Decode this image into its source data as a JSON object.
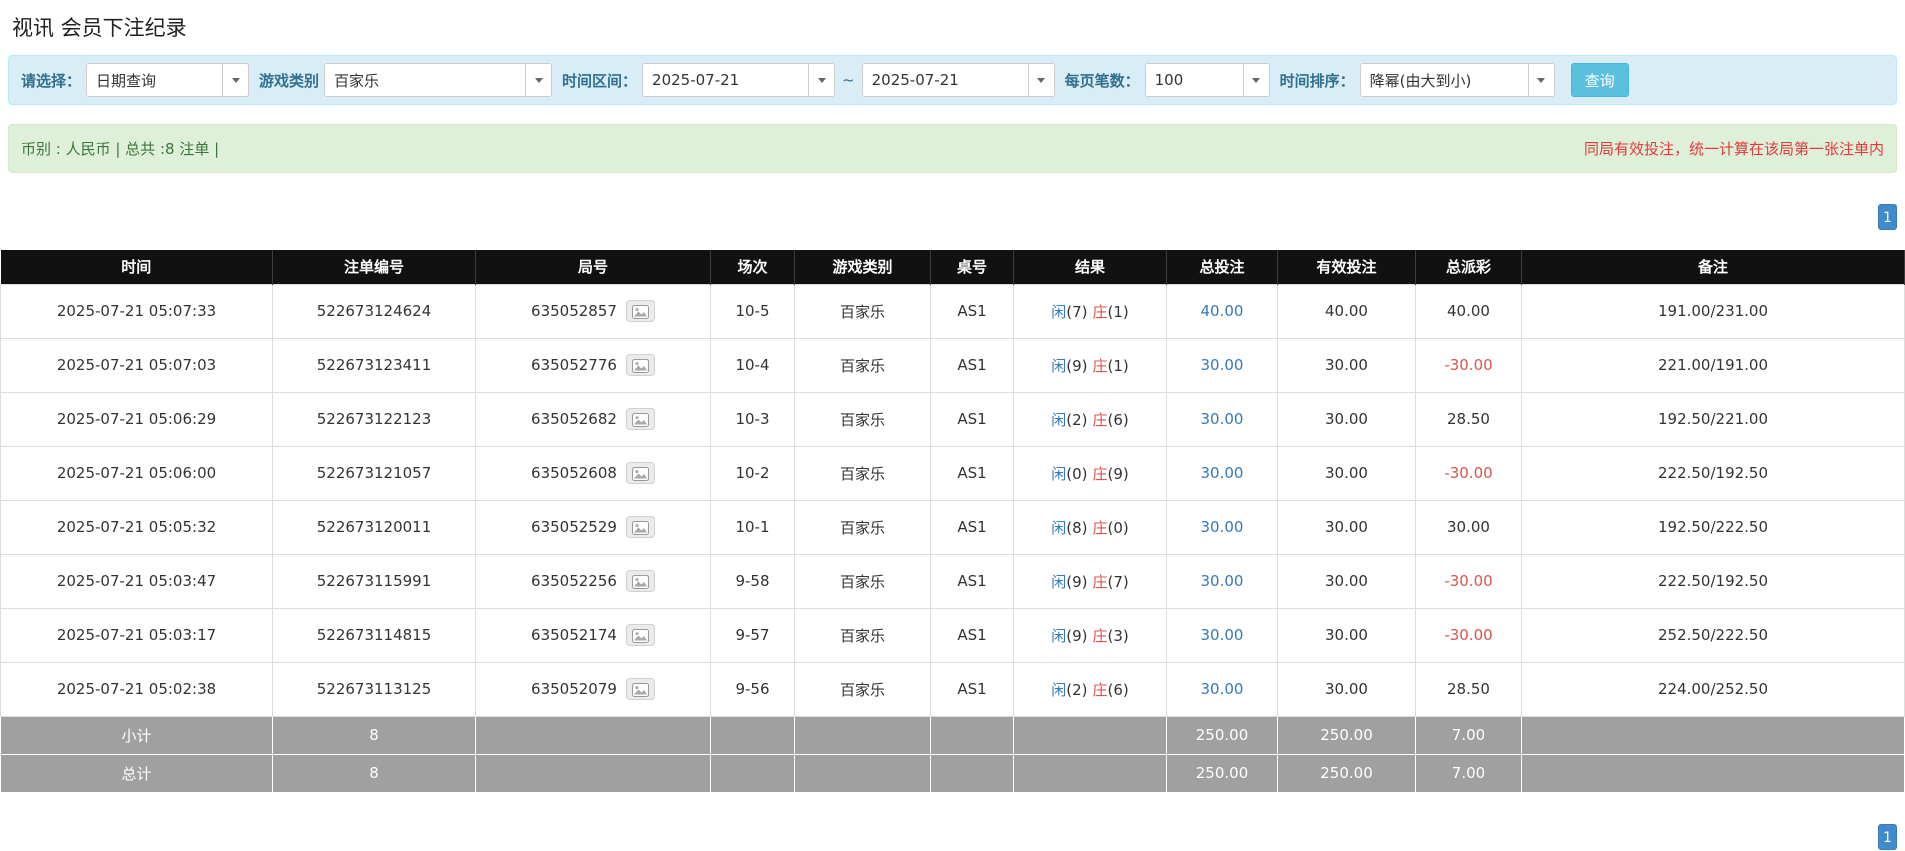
{
  "page": {
    "title": "视讯 会员下注纪录"
  },
  "filters": {
    "select_label": "请选择：",
    "select_value": "日期查询",
    "game_type_label": "游戏类别",
    "game_type_value": "百家乐",
    "date_range_label": "时间区间：",
    "date_from": "2025-07-21",
    "date_separator": "~",
    "date_to": "2025-07-21",
    "page_size_label": "每页笔数：",
    "page_size_value": "100",
    "sort_label": "时间排序：",
    "sort_value": "降幂(由大到小)",
    "search_button": "查询"
  },
  "summary": {
    "left": "币别 : 人民币 | 总共 :8 注单 |",
    "right": "同局有效投注，统一计算在该局第一张注单内"
  },
  "pagination": {
    "page": "1"
  },
  "icons": {
    "dropdown_caret": "caret-down-icon",
    "round_result": "cards-icon"
  },
  "colors": {
    "filter_bar_bg": "#d9edf7",
    "filter_label": "#31708f",
    "summary_bar_bg": "#dff0d8",
    "summary_text": "#3c763d",
    "notice_red": "#e4393c",
    "link_blue": "#337ab7",
    "player_blue": "#337ab7",
    "banker_red": "#d9534f",
    "negative_red": "#d9534f",
    "table_header_bg": "#111111",
    "table_footer_bg": "#a0a0a0",
    "search_button_bg": "#5bc0de",
    "pagination_bg": "#428bca"
  },
  "table": {
    "headers": [
      "时间",
      "注单编号",
      "局号",
      "场次",
      "游戏类别",
      "桌号",
      "结果",
      "总投注",
      "有效投注",
      "总派彩",
      "备注"
    ],
    "rows": [
      {
        "time": "2025-07-21 05:07:33",
        "bet_id": "522673124624",
        "round_id": "635052857",
        "session": "10-5",
        "game": "百家乐",
        "table_no": "AS1",
        "player": "闲",
        "player_score": "(7)",
        "banker": "庄",
        "banker_score": "(1)",
        "total_bet": "40.00",
        "valid_bet": "40.00",
        "payout": "40.00",
        "remark": "191.00/231.00"
      },
      {
        "time": "2025-07-21 05:07:03",
        "bet_id": "522673123411",
        "round_id": "635052776",
        "session": "10-4",
        "game": "百家乐",
        "table_no": "AS1",
        "player": "闲",
        "player_score": "(9)",
        "banker": "庄",
        "banker_score": "(1)",
        "total_bet": "30.00",
        "valid_bet": "30.00",
        "payout": "-30.00",
        "remark": "221.00/191.00"
      },
      {
        "time": "2025-07-21 05:06:29",
        "bet_id": "522673122123",
        "round_id": "635052682",
        "session": "10-3",
        "game": "百家乐",
        "table_no": "AS1",
        "player": "闲",
        "player_score": "(2)",
        "banker": "庄",
        "banker_score": "(6)",
        "total_bet": "30.00",
        "valid_bet": "30.00",
        "payout": "28.50",
        "remark": "192.50/221.00"
      },
      {
        "time": "2025-07-21 05:06:00",
        "bet_id": "522673121057",
        "round_id": "635052608",
        "session": "10-2",
        "game": "百家乐",
        "table_no": "AS1",
        "player": "闲",
        "player_score": "(0)",
        "banker": "庄",
        "banker_score": "(9)",
        "total_bet": "30.00",
        "valid_bet": "30.00",
        "payout": "-30.00",
        "remark": "222.50/192.50"
      },
      {
        "time": "2025-07-21 05:05:32",
        "bet_id": "522673120011",
        "round_id": "635052529",
        "session": "10-1",
        "game": "百家乐",
        "table_no": "AS1",
        "player": "闲",
        "player_score": "(8)",
        "banker": "庄",
        "banker_score": "(0)",
        "total_bet": "30.00",
        "valid_bet": "30.00",
        "payout": "30.00",
        "remark": "192.50/222.50"
      },
      {
        "time": "2025-07-21 05:03:47",
        "bet_id": "522673115991",
        "round_id": "635052256",
        "session": "9-58",
        "game": "百家乐",
        "table_no": "AS1",
        "player": "闲",
        "player_score": "(9)",
        "banker": "庄",
        "banker_score": "(7)",
        "total_bet": "30.00",
        "valid_bet": "30.00",
        "payout": "-30.00",
        "remark": "222.50/192.50"
      },
      {
        "time": "2025-07-21 05:03:17",
        "bet_id": "522673114815",
        "round_id": "635052174",
        "session": "9-57",
        "game": "百家乐",
        "table_no": "AS1",
        "player": "闲",
        "player_score": "(9)",
        "banker": "庄",
        "banker_score": "(3)",
        "total_bet": "30.00",
        "valid_bet": "30.00",
        "payout": "-30.00",
        "remark": "252.50/222.50"
      },
      {
        "time": "2025-07-21 05:02:38",
        "bet_id": "522673113125",
        "round_id": "635052079",
        "session": "9-56",
        "game": "百家乐",
        "table_no": "AS1",
        "player": "闲",
        "player_score": "(2)",
        "banker": "庄",
        "banker_score": "(6)",
        "total_bet": "30.00",
        "valid_bet": "30.00",
        "payout": "28.50",
        "remark": "224.00/252.50"
      }
    ],
    "subtotal": {
      "label": "小计",
      "count": "8",
      "total_bet": "250.00",
      "valid_bet": "250.00",
      "payout": "7.00"
    },
    "total": {
      "label": "总计",
      "count": "8",
      "total_bet": "250.00",
      "valid_bet": "250.00",
      "payout": "7.00"
    }
  }
}
